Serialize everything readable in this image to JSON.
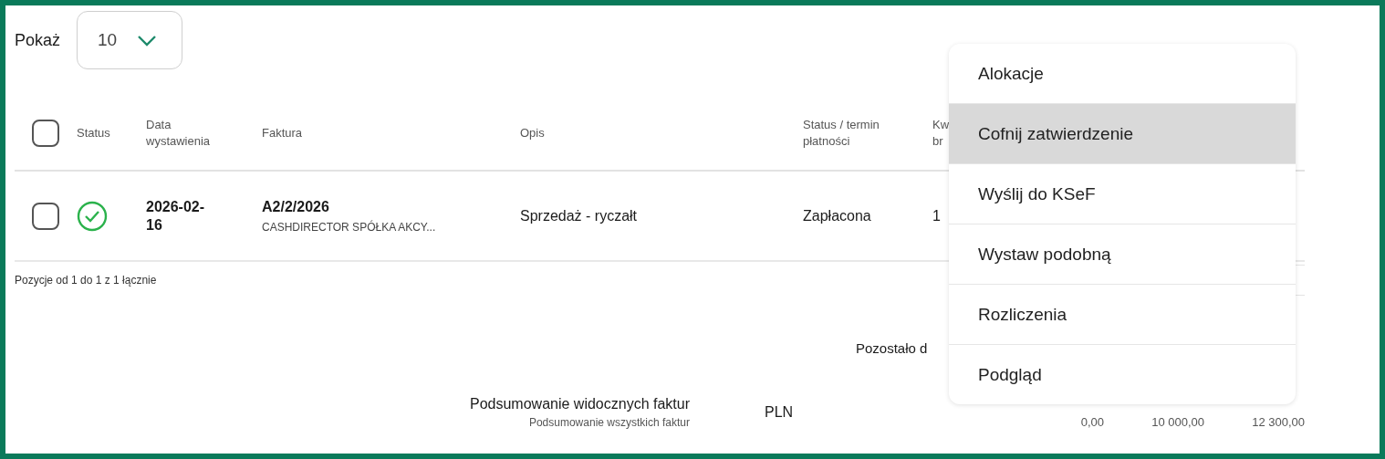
{
  "page_size": {
    "label": "Pokaż",
    "value": "10"
  },
  "table": {
    "columns": [
      {
        "kind": "checkbox",
        "checked": false
      },
      {
        "kind": "text",
        "label": "Status"
      },
      {
        "kind": "text",
        "label": "Data wystawienia"
      },
      {
        "kind": "text",
        "label": "Faktura"
      },
      {
        "kind": "text",
        "label": "Opis"
      },
      {
        "kind": "text",
        "label": "Status / termin płatności"
      },
      {
        "kind": "partial",
        "lines": [
          "Kw",
          "br"
        ]
      }
    ],
    "rows": [
      {
        "checked": false,
        "approved": true,
        "date": "2026-02-16",
        "invoice": "A2/2/2026",
        "client": "CASHDIRECTOR SPÓŁKA AKCY...",
        "description": "Sprzedaż - ryczałt",
        "payment_status": "Zapłacona",
        "column_7": "1"
      }
    ]
  },
  "range_info": "Pozycje od 1 do 1 z 1 łącznie",
  "summary": {
    "remaining_label": "Pozostało d",
    "visible_label": "Podsumowanie widocznych faktur",
    "all_label": "Podsumowanie wszystkich faktur",
    "currency": "PLN",
    "values": [
      "0,00",
      "10 000,00",
      "12 300,00"
    ]
  },
  "menu": {
    "items": [
      {
        "label": "Alokacje",
        "selected": false
      },
      {
        "label": "Cofnij zatwierdzenie",
        "selected": true
      },
      {
        "label": "Wyślij do KSeF",
        "selected": false
      },
      {
        "label": "Wystaw podobną",
        "selected": false
      },
      {
        "label": "Rozliczenia",
        "selected": false
      },
      {
        "label": "Podgląd",
        "selected": false
      }
    ]
  }
}
